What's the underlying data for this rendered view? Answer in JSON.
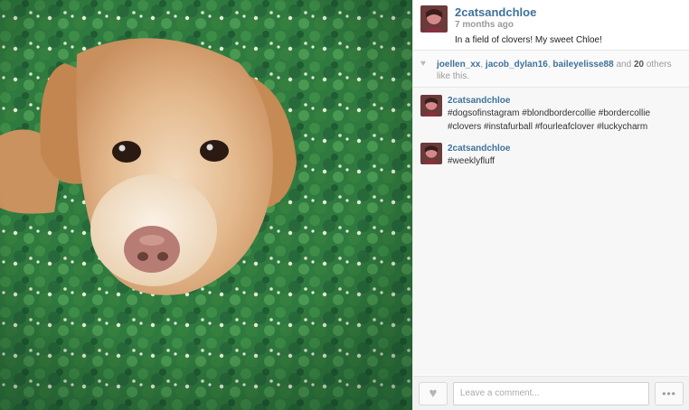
{
  "post": {
    "username": "2catsandchloe",
    "time_ago": "7 months ago",
    "caption": "In a field of clovers! My sweet Chloe!"
  },
  "likes": {
    "user1": "joellen_xx",
    "sep1": ", ",
    "user2": "jacob_dylan16",
    "sep2": ", ",
    "user3": "baileyelisse88",
    "and_text": " and ",
    "count": "20",
    "suffix": " others like this."
  },
  "comments": [
    {
      "username": "2catsandchloe",
      "text": "#dogsofinstagram #blondbordercollie #bordercollie #clovers #instafurball #fourleafclover #luckycharm"
    },
    {
      "username": "2catsandchloe",
      "text": "#weeklyfluff"
    }
  ],
  "footer": {
    "comment_placeholder": "Leave a comment...",
    "more_label": "•••",
    "like_icon": "heart-icon"
  },
  "colors": {
    "link": "#3f729b",
    "grass": "#2f7a3e",
    "fur": "#d9a877"
  }
}
